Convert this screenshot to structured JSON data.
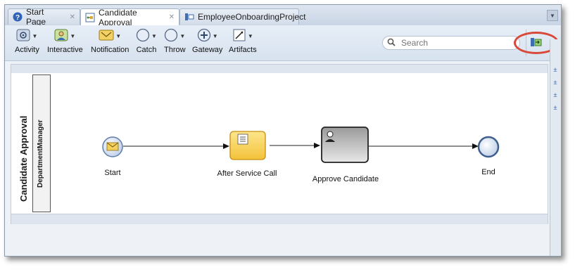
{
  "tabs": [
    {
      "label": "Start Page",
      "icon": "help-icon",
      "active": false
    },
    {
      "label": "Candidate Approval",
      "icon": "process-icon",
      "active": true
    },
    {
      "label": "EmployeeOnboardingProject",
      "icon": "project-icon",
      "active": false
    }
  ],
  "toolbar": {
    "items": [
      {
        "label": "Activity",
        "icon": "activity-icon"
      },
      {
        "label": "Interactive",
        "icon": "interactive-icon"
      },
      {
        "label": "Notification",
        "icon": "notification-icon"
      },
      {
        "label": "Catch",
        "icon": "catch-icon"
      },
      {
        "label": "Throw",
        "icon": "throw-icon"
      },
      {
        "label": "Gateway",
        "icon": "gateway-icon"
      },
      {
        "label": "Artifacts",
        "icon": "artifacts-icon"
      }
    ],
    "search_placeholder": "Search",
    "highlighted_button_icon": "pin-palette-icon",
    "highlight_color": "#d9493a"
  },
  "diagram": {
    "pool": "Candidate Approval",
    "lane": "DepartmentManager",
    "nodes": {
      "start": "Start",
      "service": "After Service Call",
      "approve": "Approve Candidate",
      "end": "End"
    }
  }
}
